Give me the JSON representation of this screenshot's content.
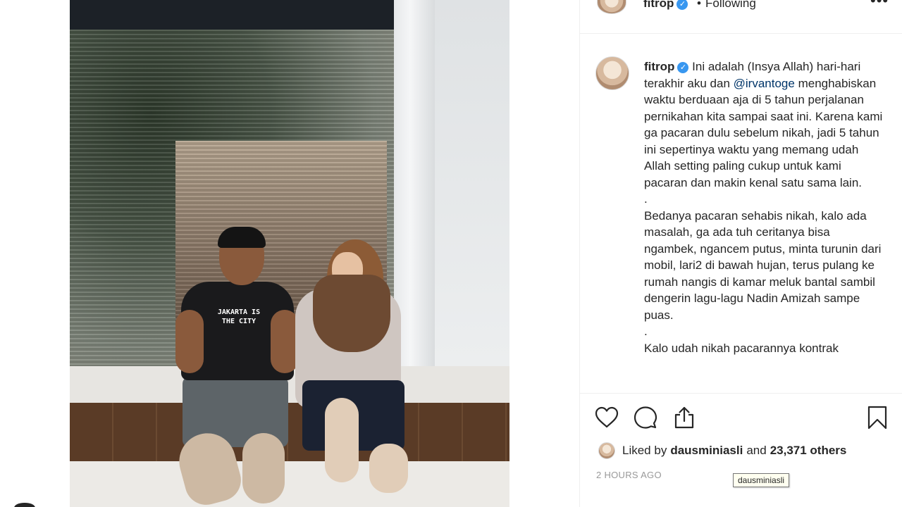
{
  "header": {
    "username": "fitrop",
    "separator": "•",
    "follow_status": "Following",
    "more_icon": "more-horizontal-icon"
  },
  "photo": {
    "tee_text": "JAKARTA IS THE CITY"
  },
  "caption": {
    "username": "fitrop",
    "verified_icon": "verified-badge-icon",
    "text_before_mention": "Ini adalah (Insya Allah) hari-hari terakhir aku dan",
    "mention": "@irvantoge",
    "text_after_mention": "menghabiskan waktu berduaan aja di 5 tahun perjalanan pernikahan kita sampai saat ini. Karena kami ga pacaran dulu sebelum nikah, jadi 5 tahun ini sepertinya waktu yang memang udah Allah setting paling cukup untuk kami pacaran dan makin kenal satu sama lain.",
    "dot1": ".",
    "paragraph2": "Bedanya pacaran sehabis nikah, kalo ada masalah, ga ada tuh ceritanya bisa ngambek, ngancem putus, minta turunin dari mobil, lari2 di bawah hujan, terus pulang ke rumah nangis di kamar meluk bantal sambil dengerin lagu-lagu Nadin Amizah sampe puas.",
    "dot2": ".",
    "paragraph3": "Kalo udah nikah pacarannya kontrak"
  },
  "actions": {
    "like_icon": "heart-icon",
    "comment_icon": "comment-bubble-icon",
    "share_icon": "share-upload-icon",
    "save_icon": "bookmark-icon"
  },
  "likes": {
    "prefix": "Liked by",
    "user": "dausminiasli",
    "conjunction": "and",
    "count": "23,371 others"
  },
  "timestamp": "2 HOURS AGO",
  "tooltip": "dausminiasli"
}
